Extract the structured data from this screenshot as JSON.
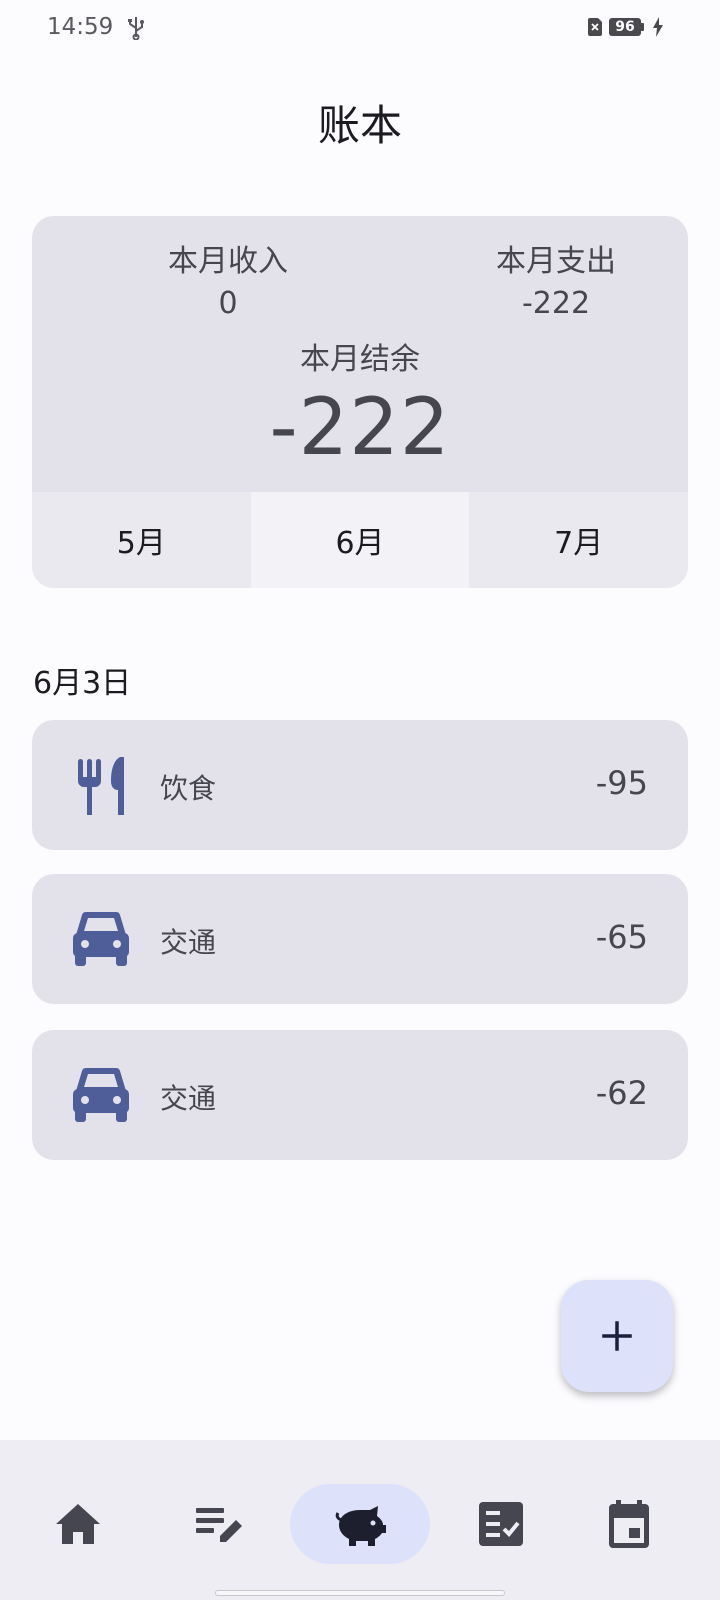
{
  "status_bar": {
    "time": "14:59",
    "battery_level": "96",
    "icons": [
      "usb-icon",
      "sim-off-icon",
      "battery-icon",
      "charging-bolt-icon"
    ]
  },
  "page": {
    "title": "账本"
  },
  "summary": {
    "income_label": "本月收入",
    "income_value": "0",
    "expense_label": "本月支出",
    "expense_value": "-222",
    "balance_label": "本月结余",
    "balance_value": "-222"
  },
  "months": {
    "tabs": [
      {
        "label": "5月"
      },
      {
        "label": "6月",
        "selected": true
      },
      {
        "label": "7月"
      }
    ]
  },
  "records": {
    "date": "6月3日",
    "items": [
      {
        "icon": "fork-knife-icon",
        "category": "饮食",
        "amount": "-95"
      },
      {
        "icon": "car-icon",
        "category": "交通",
        "amount": "-65"
      },
      {
        "icon": "car-icon",
        "category": "交通",
        "amount": "-62"
      }
    ]
  },
  "fab": {
    "icon": "plus-icon"
  },
  "bottom_nav": {
    "items": [
      {
        "icon": "home-icon"
      },
      {
        "icon": "edit-list-icon"
      },
      {
        "icon": "piggy-bank-icon",
        "active": true
      },
      {
        "icon": "checklist-icon"
      },
      {
        "icon": "calendar-icon"
      }
    ]
  },
  "colors": {
    "background": "#fcfbfe",
    "card": "#e3e1ea",
    "accent_container": "#dde1f9",
    "icon_blue": "#4f5d99",
    "nav_icon": "#45464f"
  }
}
